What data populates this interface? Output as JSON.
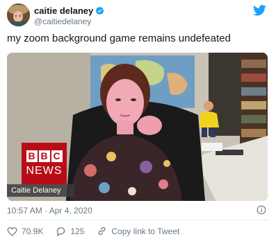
{
  "author": {
    "display_name": "caitie delaney",
    "handle": "@caitiedelaney",
    "verified": true,
    "avatar_icon": "avatar-photo"
  },
  "tweet": {
    "text": "my zoom background game remains undefeated"
  },
  "media": {
    "broadcaster_logo_letters": [
      "B",
      "B",
      "C"
    ],
    "broadcaster_logo_word": "NEWS",
    "name_strap": "Caitie Delaney"
  },
  "meta": {
    "timestamp": "10:57 AM · Apr 4, 2020"
  },
  "actions": {
    "likes": "70.9K",
    "replies": "125",
    "share_label": "Copy link to Tweet"
  },
  "colors": {
    "twitter_blue": "#1da1f2",
    "bbc_red": "#b80d17",
    "like_red": "#e0245e",
    "secondary_text": "#657786"
  },
  "icons": [
    "verified-badge-icon",
    "twitter-bird-icon",
    "info-icon",
    "heart-icon",
    "reply-icon",
    "link-icon"
  ]
}
